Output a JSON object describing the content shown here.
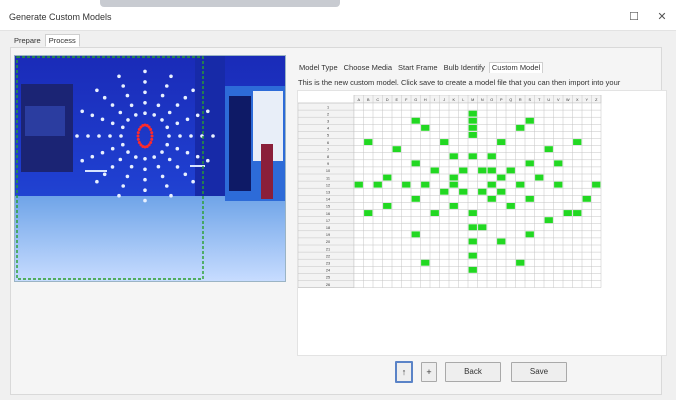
{
  "window": {
    "title": "Generate Custom Models",
    "maximize_glyph": "☐",
    "close_glyph": "✕"
  },
  "main_tabs": [
    {
      "label": "Prepare",
      "active": false
    },
    {
      "label": "Process",
      "active": true
    }
  ],
  "camera": {
    "description_icon": "camera-preview-image",
    "selection_color": "#2aa02a",
    "light_color": "#e8f0ff",
    "selected_light_color": "#ff2a2a"
  },
  "wizard_tabs": [
    {
      "label": "Model Type",
      "active": false
    },
    {
      "label": "Choose Media",
      "active": false
    },
    {
      "label": "Start Frame",
      "active": false
    },
    {
      "label": "Bulb Identify",
      "active": false
    },
    {
      "label": "Custom Model",
      "active": true
    }
  ],
  "description": "This is the new custom model. Click save to create a model file that you can then import into your",
  "grid": {
    "columns": [
      "A",
      "B",
      "C",
      "D",
      "E",
      "F",
      "G",
      "H",
      "I",
      "J",
      "K",
      "L",
      "M",
      "N",
      "O",
      "P",
      "Q",
      "R",
      "S",
      "T",
      "U",
      "V",
      "W",
      "X",
      "Y",
      "Z"
    ],
    "rows": [
      "1",
      "2",
      "3",
      "4",
      "5",
      "6",
      "7",
      "8",
      "9",
      "10",
      "11",
      "12",
      "13",
      "14",
      "15",
      "16",
      "17",
      "18",
      "19",
      "20",
      "21",
      "22",
      "23",
      "24",
      "25",
      "26"
    ],
    "cell_color": "#22d822",
    "cells": [
      [
        12,
        1
      ],
      [
        6,
        2
      ],
      [
        12,
        2
      ],
      [
        18,
        2
      ],
      [
        7,
        3
      ],
      [
        12,
        3
      ],
      [
        17,
        3
      ],
      [
        12,
        4
      ],
      [
        1,
        5
      ],
      [
        9,
        5
      ],
      [
        15,
        5
      ],
      [
        23,
        5
      ],
      [
        4,
        6
      ],
      [
        20,
        6
      ],
      [
        10,
        7
      ],
      [
        12,
        7
      ],
      [
        14,
        7
      ],
      [
        6,
        8
      ],
      [
        18,
        8
      ],
      [
        21,
        8
      ],
      [
        8,
        9
      ],
      [
        11,
        9
      ],
      [
        13,
        9
      ],
      [
        14,
        9
      ],
      [
        16,
        9
      ],
      [
        3,
        10
      ],
      [
        10,
        10
      ],
      [
        15,
        10
      ],
      [
        19,
        10
      ],
      [
        0,
        11
      ],
      [
        2,
        11
      ],
      [
        5,
        11
      ],
      [
        7,
        11
      ],
      [
        10,
        11
      ],
      [
        14,
        11
      ],
      [
        17,
        11
      ],
      [
        21,
        11
      ],
      [
        25,
        11
      ],
      [
        9,
        12
      ],
      [
        11,
        12
      ],
      [
        13,
        12
      ],
      [
        15,
        12
      ],
      [
        6,
        13
      ],
      [
        14,
        13
      ],
      [
        18,
        13
      ],
      [
        24,
        13
      ],
      [
        3,
        14
      ],
      [
        10,
        14
      ],
      [
        16,
        14
      ],
      [
        12,
        15
      ],
      [
        1,
        15
      ],
      [
        8,
        15
      ],
      [
        22,
        15
      ],
      [
        23,
        15
      ],
      [
        20,
        16
      ],
      [
        12,
        17
      ],
      [
        13,
        17
      ],
      [
        6,
        18
      ],
      [
        18,
        18
      ],
      [
        12,
        19
      ],
      [
        15,
        19
      ],
      [
        12,
        21
      ],
      [
        7,
        22
      ],
      [
        17,
        22
      ],
      [
        12,
        23
      ]
    ]
  },
  "buttons": {
    "up_glyph": "↑",
    "plus_glyph": "+",
    "back_label": "Back",
    "save_label": "Save"
  }
}
